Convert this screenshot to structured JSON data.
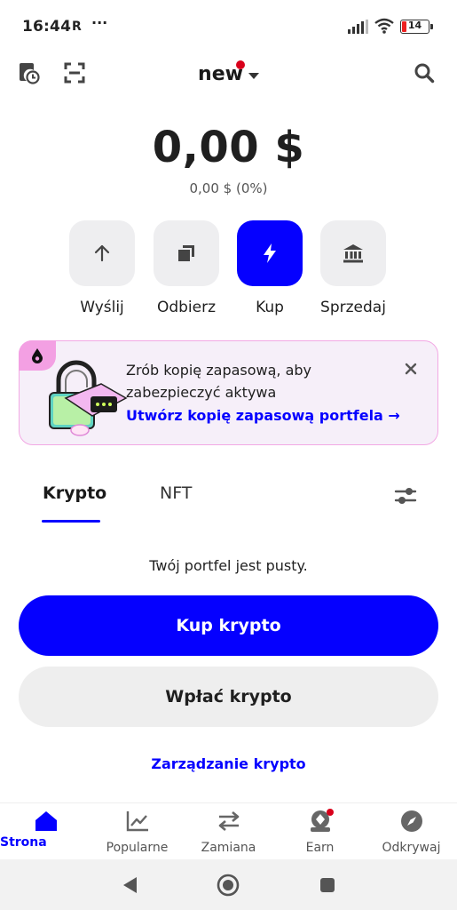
{
  "status_bar": {
    "time": "16:44",
    "carrier_icon_text": "R",
    "more": "···",
    "battery": "14",
    "icons": [
      "signal-icon",
      "wifi-icon",
      "battery-icon"
    ]
  },
  "header": {
    "wallet_name": "new",
    "icons": [
      "history-icon",
      "scan-icon",
      "search-icon"
    ]
  },
  "balance": {
    "amount": "0,00 $",
    "change": "0,00 $ (0%)"
  },
  "actions": [
    {
      "label": "Wyślij",
      "icon": "arrow-up-icon"
    },
    {
      "label": "Odbierz",
      "icon": "copy-icon"
    },
    {
      "label": "Kup",
      "icon": "lightning-icon"
    },
    {
      "label": "Sprzedaj",
      "icon": "bank-icon"
    }
  ],
  "banner": {
    "text": "Zrób kopię zapasową, aby zabezpieczyć aktywa",
    "link": "Utwórz kopię zapasową portfela →"
  },
  "tabs": {
    "crypto": "Krypto",
    "nft": "NFT"
  },
  "empty": {
    "message": "Twój portfel jest pusty.",
    "buy_button": "Kup krypto",
    "deposit_button": "Wpłać krypto",
    "manage_link": "Zarządzanie krypto"
  },
  "bottom_nav": [
    {
      "label": "Strona",
      "icon": "home-icon"
    },
    {
      "label": "Popularne",
      "icon": "chart-icon"
    },
    {
      "label": "Zamiana",
      "icon": "swap-icon"
    },
    {
      "label": "Earn",
      "icon": "earn-icon"
    },
    {
      "label": "Odkrywaj",
      "icon": "compass-icon"
    }
  ],
  "colors": {
    "accent": "#0500ff",
    "badge_red": "#d9001b",
    "banner_bg": "#f6eff9",
    "banner_border": "#f2a8e4"
  }
}
